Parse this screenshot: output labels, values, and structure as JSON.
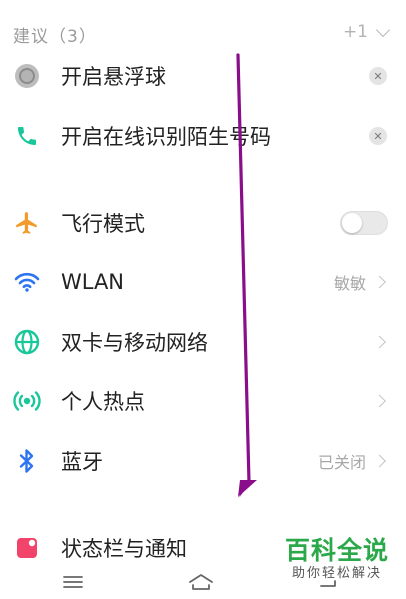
{
  "suggestions": {
    "title": "建议（3）",
    "more_label": "+1",
    "items": [
      {
        "label": "开启悬浮球",
        "dismiss": "✕"
      },
      {
        "label": "开启在线识别陌生号码",
        "dismiss": "✕"
      }
    ]
  },
  "settings": {
    "airplane": {
      "label": "飞行模式"
    },
    "wlan": {
      "label": "WLAN",
      "value": "敏敏"
    },
    "dual_sim": {
      "label": "双卡与移动网络"
    },
    "hotspot": {
      "label": "个人热点"
    },
    "bluetooth": {
      "label": "蓝牙",
      "value": "已关闭"
    },
    "status_bar": {
      "label": "状态栏与通知"
    }
  },
  "watermark": {
    "title": "百科全说",
    "subtitle": "助你轻松解决"
  },
  "colors": {
    "accent_green": "#19c79a",
    "accent_blue": "#2d74f0",
    "airplane_orange": "#f39b2a",
    "status_red": "#f2436a",
    "arrow_purple": "#8a0d8a",
    "watermark_green": "#2aa84a"
  },
  "icons": {
    "floating_ball": "floating-ball-icon",
    "phone": "phone-icon",
    "airplane": "airplane-icon",
    "wifi": "wifi-icon",
    "globe": "globe-icon",
    "hotspot": "hotspot-icon",
    "bluetooth": "bluetooth-icon",
    "status_bar": "notification-icon"
  }
}
